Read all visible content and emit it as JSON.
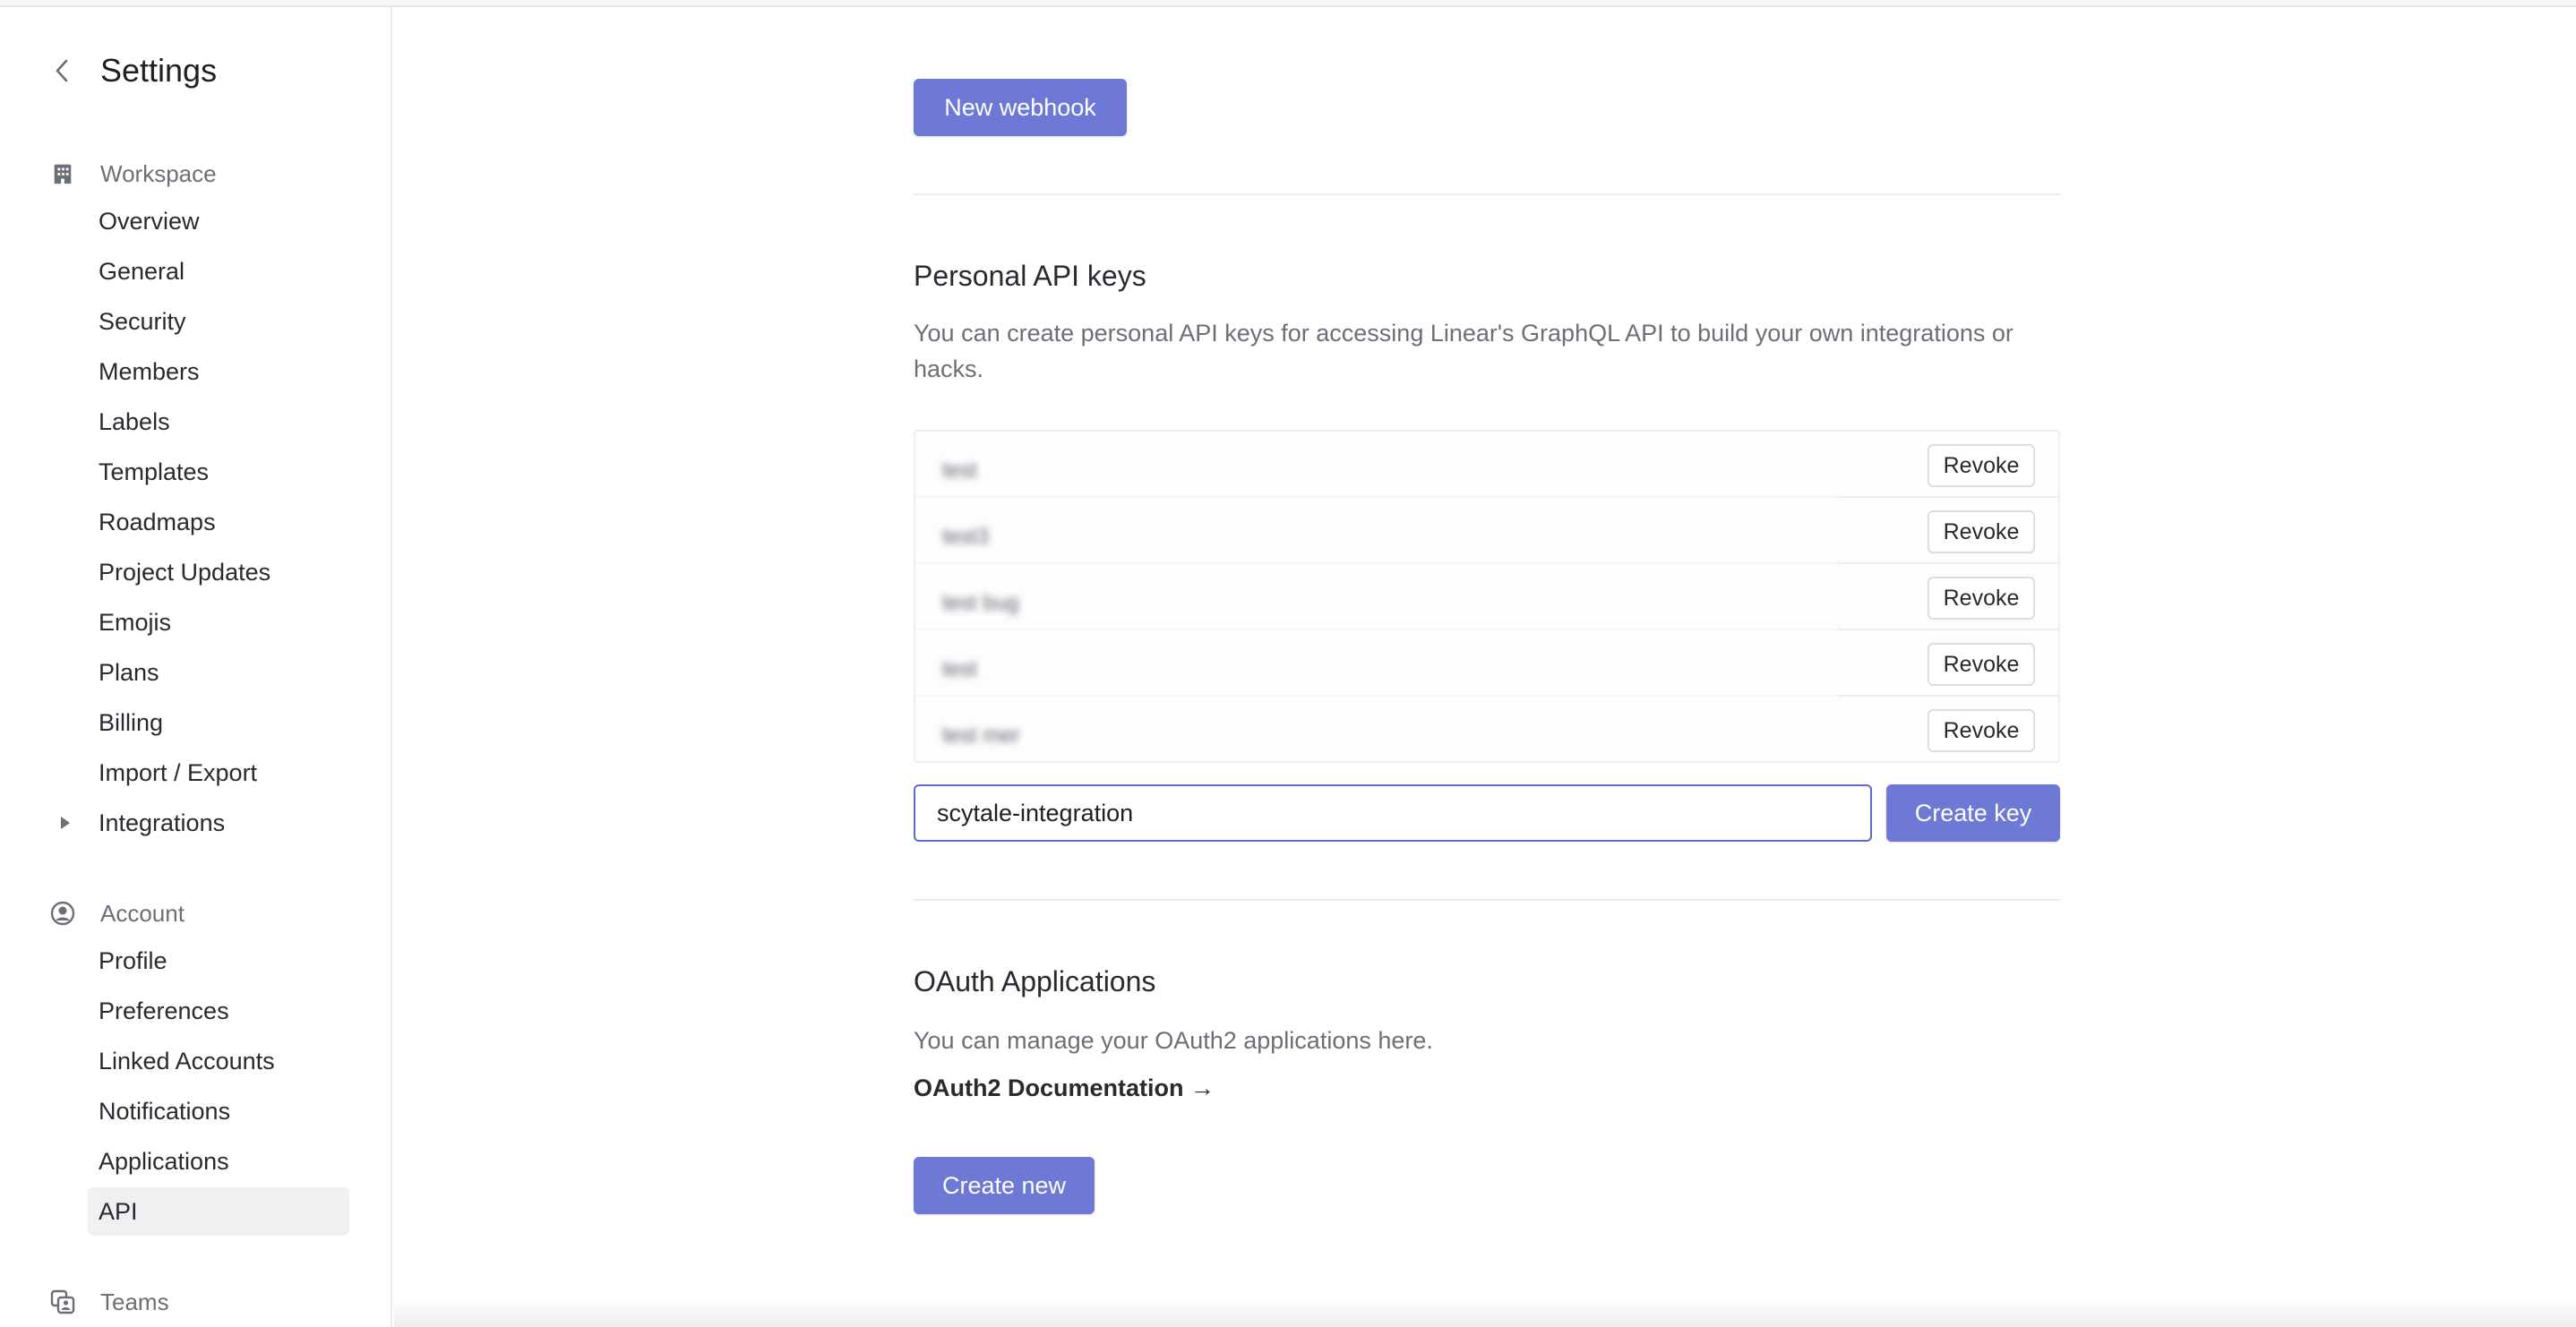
{
  "sidebar": {
    "title": "Settings",
    "workspace": {
      "label": "Workspace",
      "items": [
        {
          "label": "Overview"
        },
        {
          "label": "General"
        },
        {
          "label": "Security"
        },
        {
          "label": "Members"
        },
        {
          "label": "Labels"
        },
        {
          "label": "Templates"
        },
        {
          "label": "Roadmaps"
        },
        {
          "label": "Project Updates"
        },
        {
          "label": "Emojis"
        },
        {
          "label": "Plans"
        },
        {
          "label": "Billing"
        },
        {
          "label": "Import / Export"
        },
        {
          "label": "Integrations"
        }
      ]
    },
    "account": {
      "label": "Account",
      "items": [
        {
          "label": "Profile"
        },
        {
          "label": "Preferences"
        },
        {
          "label": "Linked Accounts"
        },
        {
          "label": "Notifications"
        },
        {
          "label": "Applications"
        },
        {
          "label": "API"
        }
      ]
    },
    "teams": {
      "label": "Teams"
    }
  },
  "main": {
    "new_webhook_label": "New webhook",
    "api_keys": {
      "title": "Personal API keys",
      "description": "You can create personal API keys for accessing Linear's GraphQL API to build your own integrations or hacks.",
      "keys": [
        {
          "name": "test",
          "revoke_label": "Revoke"
        },
        {
          "name": "test3",
          "revoke_label": "Revoke"
        },
        {
          "name": "test bug",
          "revoke_label": "Revoke"
        },
        {
          "name": "test",
          "revoke_label": "Revoke"
        },
        {
          "name": "test mer",
          "revoke_label": "Revoke"
        }
      ],
      "input_value": "scytale-integration",
      "create_key_label": "Create key"
    },
    "oauth": {
      "title": "OAuth Applications",
      "description": "You can manage your OAuth2 applications here.",
      "doc_link": "OAuth2 Documentation →",
      "create_new_label": "Create new"
    }
  },
  "colors": {
    "accent": "#6e79d6",
    "input_border": "#5e69c9"
  }
}
